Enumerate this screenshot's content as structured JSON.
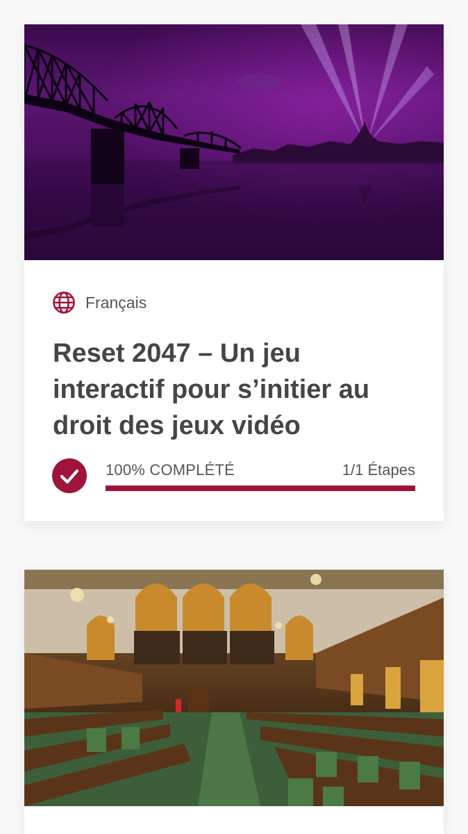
{
  "courses": [
    {
      "image_alt": "Purple night scene with bridge and Parliament silhouette",
      "language_icon": "globe-icon",
      "language": "Français",
      "title": "Reset 2047 – Un jeu interactif pour s’initier au droit des jeux vidéo",
      "status_icon": "check-circle-icon",
      "progress_text": "100% COMPLÉTÉ",
      "progress_fraction": 1.0,
      "steps_text": "1/1 Étapes"
    },
    {
      "image_alt": "House of Commons chamber interior"
    }
  ],
  "colors": {
    "accent": "#a0133a",
    "text": "#454545",
    "muted_text": "#555555",
    "page_background": "#f8f8f8",
    "card_background": "#ffffff"
  }
}
